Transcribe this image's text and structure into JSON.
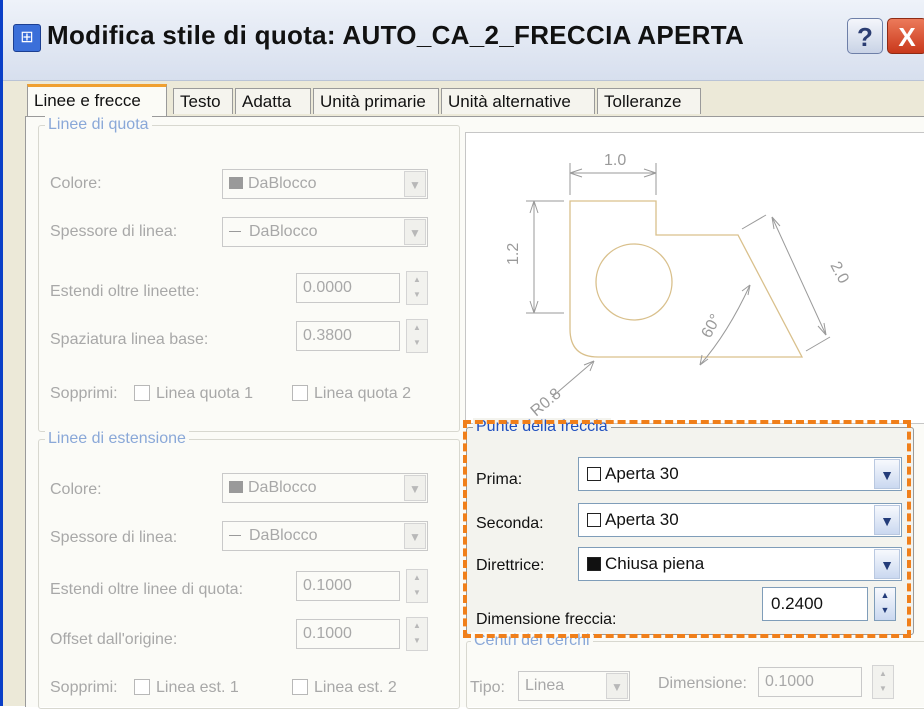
{
  "window": {
    "title": "Modifica stile di quota: AUTO_CA_2_FRECCIA APERTA",
    "help_label": "?",
    "close_label": "X"
  },
  "tabs": [
    {
      "label": "Linee e frecce"
    },
    {
      "label": "Testo"
    },
    {
      "label": "Adatta"
    },
    {
      "label": "Unità primarie"
    },
    {
      "label": "Unità alternative"
    },
    {
      "label": "Tolleranze"
    }
  ],
  "dimension_lines": {
    "group_label": "Linee di quota",
    "color_label": "Colore:",
    "color_value": "DaBlocco",
    "lineweight_label": "Spessore di linea:",
    "lineweight_value": "DaBlocco",
    "extend_label": "Estendi oltre lineette:",
    "extend_value": "0.0000",
    "baseline_label": "Spaziatura linea base:",
    "baseline_value": "0.3800",
    "suppress_label": "Sopprimi:",
    "suppress1_label": "Linea quota 1",
    "suppress2_label": "Linea quota 2"
  },
  "extension_lines": {
    "group_label": "Linee di estensione",
    "color_label": "Colore:",
    "color_value": "DaBlocco",
    "lineweight_label": "Spessore di linea:",
    "lineweight_value": "DaBlocco",
    "extend_label": "Estendi oltre linee di quota:",
    "extend_value": "0.1000",
    "offset_label": "Offset dall'origine:",
    "offset_value": "0.1000",
    "suppress_label": "Sopprimi:",
    "suppress1_label": "Linea est. 1",
    "suppress2_label": "Linea est. 2"
  },
  "preview": {
    "dim_top": "1.0",
    "dim_left": "1.2",
    "dim_diag": "2.0",
    "dim_angle": "60°",
    "dim_radius": "R0.8"
  },
  "arrowheads": {
    "group_label": "Punte della freccia",
    "first_label": "Prima:",
    "first_value": "Aperta 30",
    "second_label": "Seconda:",
    "second_value": "Aperta 30",
    "leader_label": "Direttrice:",
    "leader_value": "Chiusa piena",
    "size_label": "Dimensione freccia:",
    "size_value": "0.2400"
  },
  "center_marks": {
    "group_label": "Centri dei cerchi",
    "type_label": "Tipo:",
    "type_value": "Linea",
    "size_label": "Dimensione:",
    "size_value": "0.1000"
  },
  "colors": {
    "accent": "#f07f1a",
    "title_blue": "#0a3fc7",
    "group_label_disabled": "#8aa8d8",
    "preview_lines": "#d9c08c"
  }
}
